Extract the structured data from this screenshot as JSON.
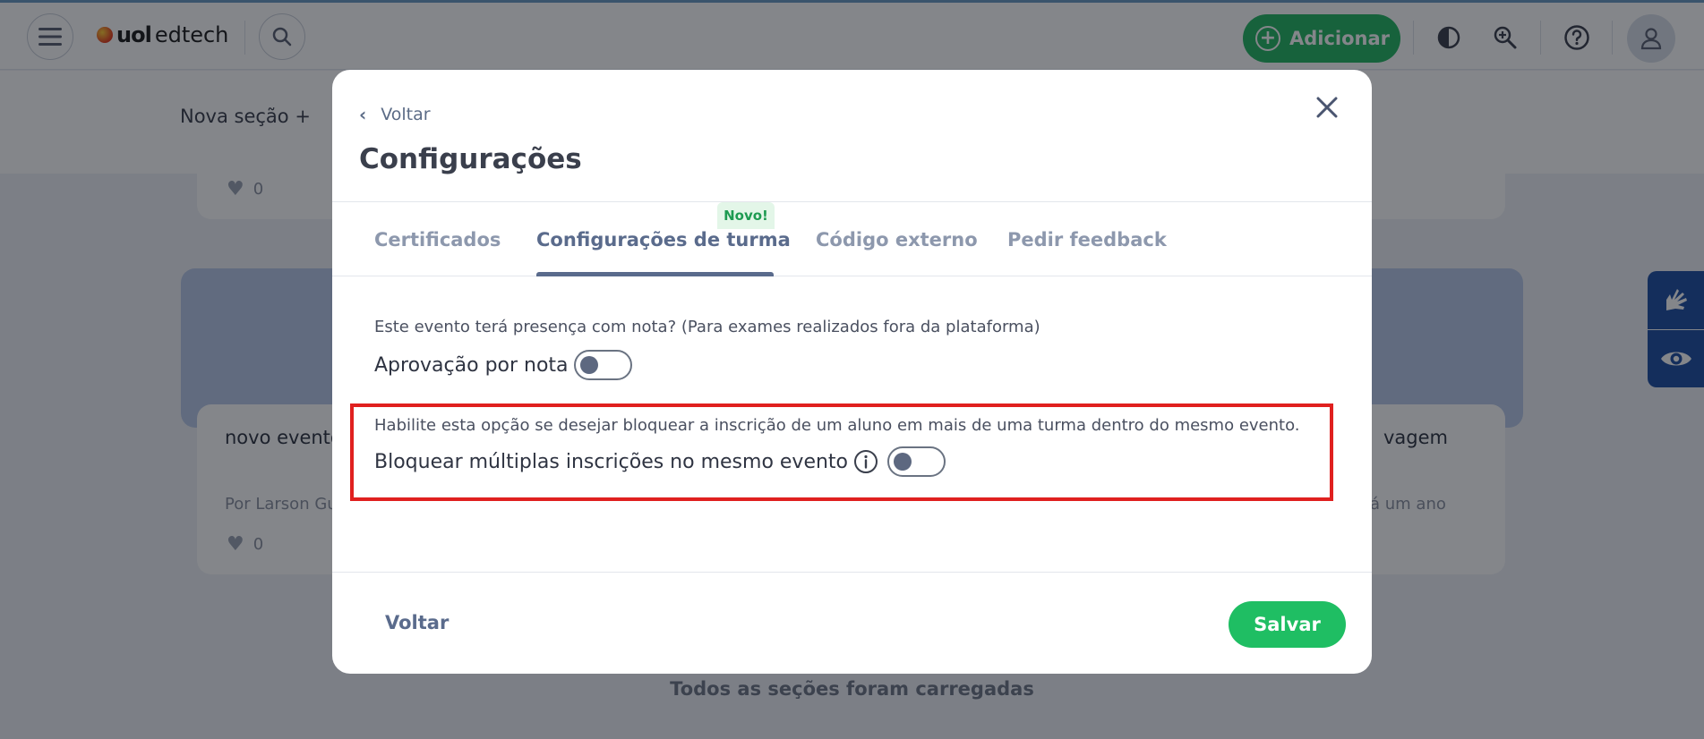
{
  "header": {
    "logo_uol": "uol",
    "logo_edtech": "edtech",
    "add_label": "Adicionar",
    "icons": [
      "menu-icon",
      "search-icon",
      "plus-circle-icon",
      "contrast-icon",
      "zoom-in-icon",
      "help-icon",
      "user-icon"
    ]
  },
  "background": {
    "nova_secao": "Nova seção",
    "card_top_likes": "0",
    "card_left_title": "novo evento",
    "card_left_author": "Por Larson Gu",
    "card_left_likes": "0",
    "card_right_title": "vagem",
    "card_right_time": "á um ano",
    "loaded_text": "Todos as seções foram carregadas"
  },
  "modal": {
    "back_label": "Voltar",
    "title": "Configurações",
    "tabs": [
      {
        "label": "Certificados",
        "active": false
      },
      {
        "label": "Configurações de turma",
        "active": true
      },
      {
        "label": "Código externo",
        "active": false
      },
      {
        "label": "Pedir feedback",
        "active": false
      }
    ],
    "novo_badge": "Novo!",
    "grade_question": "Este evento terá presença com nota? (Para exames realizados fora da plataforma)",
    "grade_toggle_label": "Aprovação por nota",
    "grade_toggle_on": false,
    "block_description": "Habilite esta opção se desejar bloquear a inscrição de um aluno em mais de uma turma dentro do mesmo evento.",
    "block_toggle_label": "Bloquear múltiplas inscrições no mesmo evento",
    "block_toggle_on": false,
    "footer_back": "Voltar",
    "save_label": "Salvar"
  },
  "colors": {
    "brand_green": "#25b662",
    "save_green": "#1fbe63",
    "tab_active": "#5a6b8c",
    "highlight_red": "#e0201f",
    "a11y_blue": "#1f4ea3"
  }
}
